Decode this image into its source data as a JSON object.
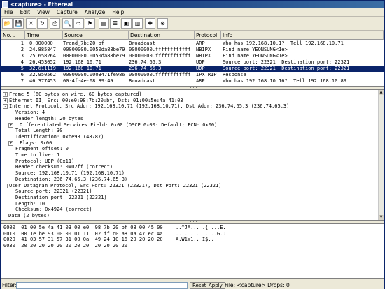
{
  "title": "<capture> - Ethereal",
  "menu": [
    "File",
    "Edit",
    "View",
    "Capture",
    "Analyze",
    "Help"
  ],
  "toolbar_icons": [
    "open-icon",
    "save-icon",
    "close-icon",
    "reload-icon",
    "print-icon",
    "find-icon",
    "go-to-icon",
    "filter-icon",
    "colorize-icon",
    "preferences-icon",
    "zoom-icon",
    "stats-icon",
    "settings-icon",
    "help-icon"
  ],
  "packet_list": {
    "headers": [
      "No. .",
      "Time",
      "Source",
      "Destination",
      "Protocol",
      "Info"
    ],
    "rows": [
      {
        "no": "1",
        "time": "0.000000",
        "src": "Trend_7b:20:bf",
        "dst": "Broadcast",
        "proto": "ARP",
        "info": "Who has 192.168.10.1?  Tell 192.168.10.71"
      },
      {
        "no": "2",
        "time": "24.885847",
        "src": "00000000.0050da88be79",
        "dst": "00000000.ffffffffffff",
        "proto": "NBIPX",
        "info": "Find name YEONSUNG<1e>"
      },
      {
        "no": "3",
        "time": "25.658264",
        "src": "00000000.0050da88be79",
        "dst": "00000000.ffffffffffff",
        "proto": "NBIPX",
        "info": "Find name YEONSUNG<1e>"
      },
      {
        "no": "4",
        "time": "26.453052",
        "src": "192.168.10.71",
        "dst": "236.74.65.3",
        "proto": "UDP",
        "info": "Source port: 22321  Destination port: 22321"
      },
      {
        "no": "5",
        "time": "32.611119",
        "src": "192.168.10.71",
        "dst": "236.74.65.3",
        "proto": "UDP",
        "info": "Source port: 22321  Destination port: 22321"
      },
      {
        "no": "6",
        "time": "32.950562",
        "src": "00000000.0003471fe986",
        "dst": "00000000.ffffffffffff",
        "proto": "IPX RIP",
        "info": "Response"
      },
      {
        "no": "7",
        "time": "46.377453",
        "src": "00:4f:4e:08:89:49",
        "dst": "Broadcast",
        "proto": "ARP",
        "info": "Who has 192.168.10.16?  Tell 192.168.10.89"
      }
    ]
  },
  "detail": [
    {
      "indent": 0,
      "box": "+",
      "text": "Frame 5 (60 bytes on wire, 60 bytes captured)"
    },
    {
      "indent": 0,
      "box": "+",
      "text": "Ethernet II, Src: 00:e0:98:7b:20:bf, Dst: 01:00:5e:4a:41:03"
    },
    {
      "indent": 0,
      "box": "-",
      "text": "Internet Protocol, Src Addr: 192.168.10.71 (192.168.10.71), Dst Addr: 236.74.65.3 (236.74.65.3)"
    },
    {
      "indent": 1,
      "box": "",
      "text": "Version: 4"
    },
    {
      "indent": 1,
      "box": "",
      "text": "Header length: 20 bytes"
    },
    {
      "indent": 1,
      "box": "+",
      "text": "Differentiated Services Field: 0x00 (DSCP 0x00: Default; ECN: 0x00)"
    },
    {
      "indent": 1,
      "box": "",
      "text": "Total Length: 30"
    },
    {
      "indent": 1,
      "box": "",
      "text": "Identification: 0xbe93 (48787)"
    },
    {
      "indent": 1,
      "box": "+",
      "text": "Flags: 0x00"
    },
    {
      "indent": 1,
      "box": "",
      "text": "Fragment offset: 0"
    },
    {
      "indent": 1,
      "box": "",
      "text": "Time to live: 1"
    },
    {
      "indent": 1,
      "box": "",
      "text": "Protocol: UDP (0x11)"
    },
    {
      "indent": 1,
      "box": "",
      "text": "Header checksum: 0x02ff (correct)"
    },
    {
      "indent": 1,
      "box": "",
      "text": "Source: 192.168.10.71 (192.168.10.71)"
    },
    {
      "indent": 1,
      "box": "",
      "text": "Destination: 236.74.65.3 (236.74.65.3)"
    },
    {
      "indent": 0,
      "box": "-",
      "text": "User Datagram Protocol, Src Port: 22321 (22321), Dst Port: 22321 (22321)"
    },
    {
      "indent": 1,
      "box": "",
      "text": "Source port: 22321 (22321)"
    },
    {
      "indent": 1,
      "box": "",
      "text": "Destination port: 22321 (22321)"
    },
    {
      "indent": 1,
      "box": "",
      "text": "Length: 10"
    },
    {
      "indent": 1,
      "box": "",
      "text": "Checksum: 0x4924 (correct)"
    },
    {
      "indent": 0,
      "box": "",
      "text": "Data (2 bytes)"
    }
  ],
  "hex": [
    {
      "off": "0000",
      "bytes": "01 00 5e 4a 41 03 00 e0  98 7b 20 bf 08 00 45 00",
      "ascii": "..^JA... .{ ...E."
    },
    {
      "off": "0010",
      "bytes": "00 1e be 93 00 00 01 11  02 ff c0 a8 0a 47 ec 4a",
      "ascii": "........ .....G.J"
    },
    {
      "off": "0020",
      "bytes": "41 03 57 31 57 31 00 0a  49 24 10 16 20 20 20 20",
      "ascii": "A.W1W1.. I$..    "
    },
    {
      "off": "0030",
      "bytes": "20 20 20 20 20 20 20 20  20 20 20 20",
      "ascii": "        "
    }
  ],
  "status": {
    "filter_label": "Filter:",
    "reset": "Reset",
    "apply": "Apply",
    "info": "File: <capture>  Drops: 0"
  }
}
